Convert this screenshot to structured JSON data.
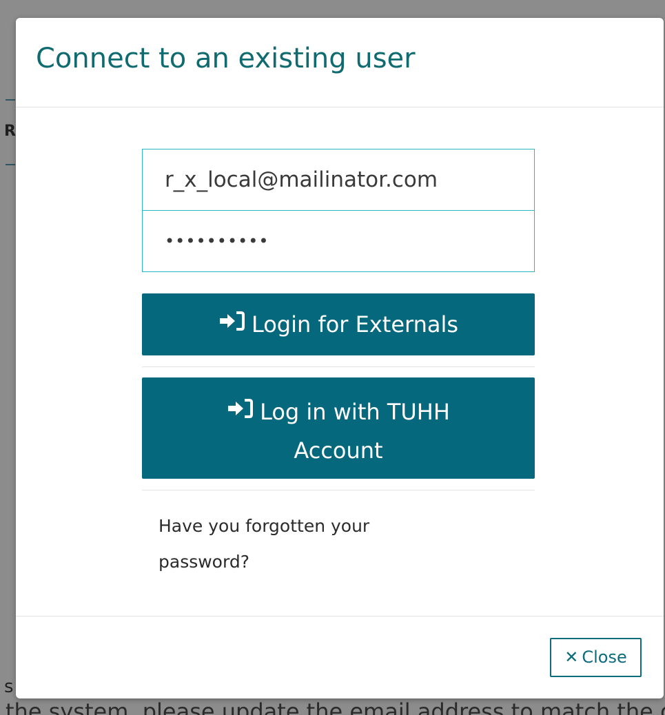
{
  "modal": {
    "title": "Connect to an existing user",
    "email_value": "r_x_local@mailinator.com",
    "password_value": "••••••••••",
    "login_externals_label": "Login for Externals",
    "login_tuhh_label_line1": "Log in with TUHH",
    "login_tuhh_label_line2": "Account",
    "forgot_line1": "Have you forgotten your",
    "forgot_line2": "password?",
    "close_label": "Close"
  },
  "background": {
    "fragment_r": "R",
    "fragment_s": "s",
    "bottom_text": "the system, please update the email address to match the one"
  },
  "colors": {
    "title": "#0f6b6f",
    "primary_button": "#05687c",
    "input_border": "#2ab5c2"
  },
  "icons": {
    "login": "sign-in-icon",
    "close": "times-icon"
  }
}
